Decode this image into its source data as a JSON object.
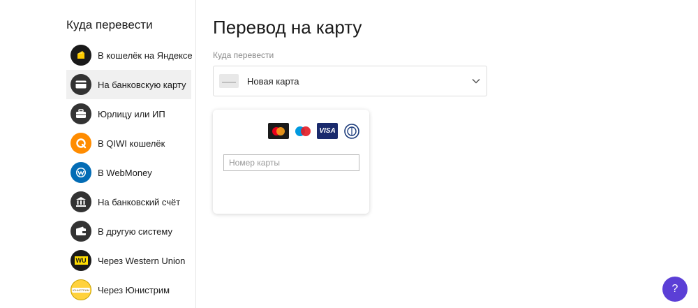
{
  "sidebar": {
    "title": "Куда перевести",
    "items": [
      {
        "label": "В кошелёк на Яндексе",
        "icon": "yandex-wallet-icon",
        "active": false
      },
      {
        "label": "На банковскую карту",
        "icon": "bank-card-icon",
        "active": true
      },
      {
        "label": "Юрлицу или ИП",
        "icon": "briefcase-icon",
        "active": false
      },
      {
        "label": "В QIWI кошелёк",
        "icon": "qiwi-icon",
        "active": false
      },
      {
        "label": "В WebMoney",
        "icon": "webmoney-icon",
        "active": false
      },
      {
        "label": "На банковский счёт",
        "icon": "bank-building-icon",
        "active": false
      },
      {
        "label": "В другую систему",
        "icon": "wallet-icon",
        "active": false
      },
      {
        "label": "Через Western Union",
        "icon": "western-union-icon",
        "brand_text": "WU",
        "active": false
      },
      {
        "label": "Через Юнистрим",
        "icon": "unistream-icon",
        "brand_text": "ЮНИСТРИМ",
        "active": false
      }
    ]
  },
  "main": {
    "title": "Перевод на карту",
    "destination_label": "Куда перевести",
    "destination_value": "Новая карта",
    "card_form": {
      "brands": [
        "mastercard-icon",
        "maestro-icon",
        "visa-icon",
        "diners-club-icon"
      ],
      "visa_text": "VISA",
      "card_number_placeholder": "Номер карты"
    }
  },
  "help": {
    "label": "?"
  },
  "colors": {
    "accent": "#5b3fd6",
    "yandex": "#ffcc00",
    "qiwi": "#ff8c00",
    "webmoney": "#036cb5",
    "western_union": "#ffdd00",
    "dark_icon": "#333333"
  }
}
